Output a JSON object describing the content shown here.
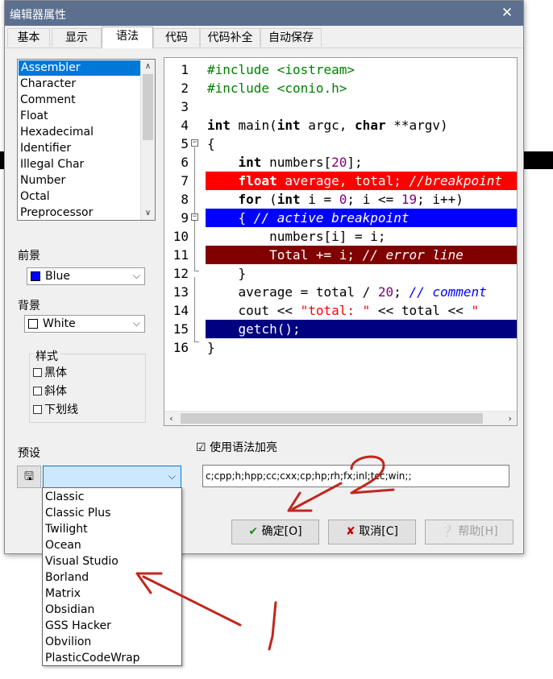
{
  "window": {
    "title": "编辑器属性",
    "close_glyph": "✕"
  },
  "tabs": [
    {
      "label": "基本"
    },
    {
      "label": "显示"
    },
    {
      "label": "语法",
      "active": true
    },
    {
      "label": "代码"
    },
    {
      "label": "代码补全"
    },
    {
      "label": "自动保存"
    }
  ],
  "syntax_items": [
    "Assembler",
    "Character",
    "Comment",
    "Float",
    "Hexadecimal",
    "Identifier",
    "Illegal Char",
    "Number",
    "Octal",
    "Preprocessor"
  ],
  "selected_syntax_item": "Assembler",
  "foreground": {
    "label": "前景",
    "value": "Blue",
    "swatch_color": "#0000ff"
  },
  "background": {
    "label": "背景",
    "value": "White",
    "swatch_color": "#ffffff"
  },
  "style_group": {
    "title": "样式",
    "bold": "黑体",
    "italic": "斜体",
    "underline": "下划线"
  },
  "editor": {
    "line_numbers": [
      "1",
      "2",
      "3",
      "4",
      "5",
      "6",
      "7",
      "8",
      "9",
      "10",
      "11",
      "12",
      "13",
      "14",
      "15",
      "16"
    ]
  },
  "preset": {
    "label": "预设",
    "value": "",
    "options": [
      "Classic",
      "Classic Plus",
      "Twilight",
      "Ocean",
      "Visual Studio",
      "Borland",
      "Matrix",
      "Obsidian",
      "GSS Hacker",
      "Obvilion",
      "PlasticCodeWrap"
    ]
  },
  "syntax_highlight": {
    "label": "使用语法加亮",
    "checked": true,
    "extensions": "c;cpp;h;hpp;cc;cxx;cp;hp;rh;fx;inl;tcc;win;;"
  },
  "buttons": {
    "ok": "确定[O]",
    "cancel": "取消[C]",
    "help": "帮助[H]"
  },
  "colors": {
    "titlebar": "#5c6f8e",
    "breakpoint": "#ff0000",
    "active_breakpoint": "#0000ff",
    "error_line": "#800000",
    "selection": "#000080",
    "annotation": "#c0271f"
  },
  "annotations": {
    "number_1": "1",
    "number_2": "2"
  }
}
